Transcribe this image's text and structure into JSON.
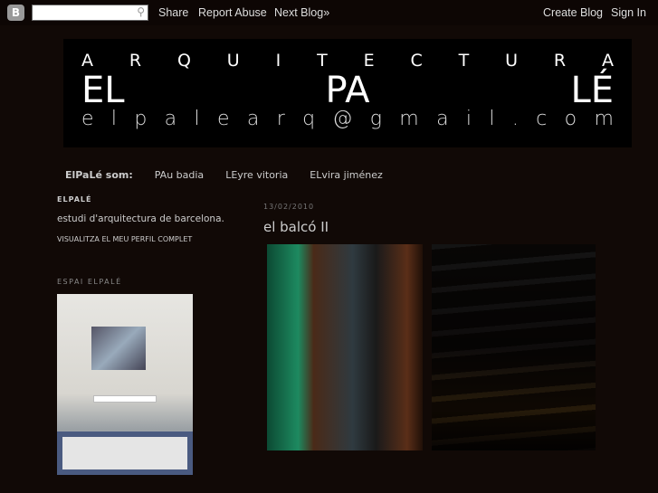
{
  "navbar": {
    "search_placeholder": "",
    "share": "Share",
    "report_abuse": "Report Abuse",
    "next_blog": "Next Blog»",
    "create_blog": "Create Blog",
    "sign_in": "Sign In"
  },
  "header": {
    "line1": [
      "A",
      "R",
      "Q",
      "U",
      "I",
      "T",
      "E",
      "C",
      "T",
      "U",
      "R",
      "A"
    ],
    "line2": [
      "EL",
      "PA",
      "LÉ"
    ],
    "line3": [
      "e",
      "l",
      "p",
      "a",
      "l",
      "e",
      "a",
      "r",
      "q",
      "@",
      "g",
      "m",
      "a",
      "i",
      "l",
      ".",
      "c",
      "o",
      "m"
    ]
  },
  "tabs": [
    "ElPaLé som:",
    "PAu badia",
    "LEyre vitoria",
    "ELvira jiménez"
  ],
  "sidebar": {
    "profile_title": "ELPALÉ",
    "description": "estudi d'arquitectura de barcelona.",
    "profile_link": "VISUALITZA EL MEU PERFIL COMPLET",
    "section_title": "ESPAI ELPALÉ"
  },
  "post": {
    "date": "13/02/2010",
    "title": "el balcó II"
  }
}
